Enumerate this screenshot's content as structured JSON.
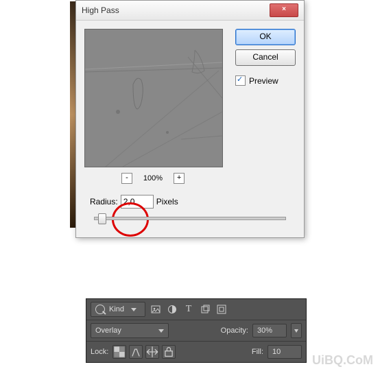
{
  "dialog": {
    "title": "High Pass",
    "close_glyph": "×",
    "zoom_label": "100%",
    "zoom_out_glyph": "-",
    "zoom_in_glyph": "+",
    "radius_label": "Radius:",
    "radius_value": "2,0",
    "radius_unit": "Pixels",
    "ok_label": "OK",
    "cancel_label": "Cancel",
    "preview_label": "Preview"
  },
  "panel": {
    "kind_label": "Kind",
    "blend_mode": "Overlay",
    "opacity_label": "Opacity:",
    "opacity_value": "30%",
    "lock_label": "Lock:",
    "fill_label": "Fill:",
    "fill_value": "10"
  },
  "watermark": "UiBQ.CoM"
}
